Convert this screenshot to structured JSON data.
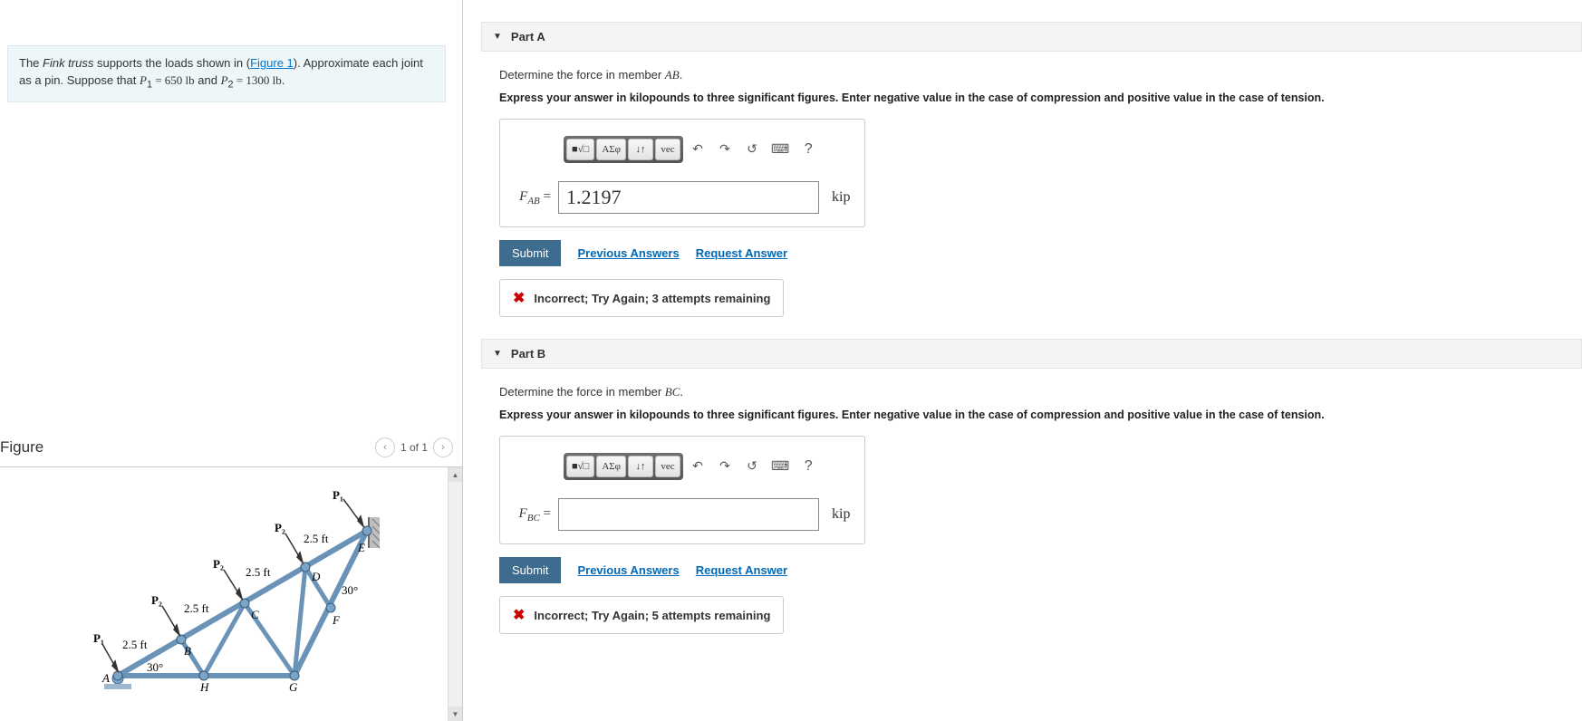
{
  "problem": {
    "html_segments": {
      "prefix": "The ",
      "italic": "Fink truss",
      "mid": " supports the loads shown in (",
      "link": "Figure 1",
      "suffix_before_vars": "). Approximate each joint as a pin. Suppose that ",
      "p1_var": "P",
      "p1_sub": "1",
      "p1_val": " = 650 lb",
      "and": " and ",
      "p2_var": "P",
      "p2_sub": "2",
      "p2_val": " = 1300 lb",
      "period": "."
    }
  },
  "figure": {
    "title": "Figure",
    "pager": "1 of 1",
    "labels": {
      "P1_left": "P₁",
      "P1_top": "P₁",
      "P2_a": "P₂",
      "P2_b": "P₂",
      "P2_c": "P₂",
      "d25_1": "2.5 ft",
      "d25_2": "2.5 ft",
      "d25_3": "2.5 ft",
      "d25_4": "2.5 ft",
      "ang30_l": "30°",
      "ang30_r": "30°",
      "A": "A",
      "B": "B",
      "C": "C",
      "D": "D",
      "E": "E",
      "F": "F",
      "G": "G",
      "H": "H"
    }
  },
  "parts": [
    {
      "id": "A",
      "title": "Part A",
      "prompt_prefix": "Determine the force in member ",
      "prompt_member": "AB",
      "prompt_suffix": ".",
      "instructions": "Express your answer in kilopounds to three significant figures. Enter negative value in the case of compression and positive value in the case of tension.",
      "var_label": "F",
      "var_sub": "AB",
      "equals": " = ",
      "input_value": "1.2197",
      "unit": "kip",
      "submit": "Submit",
      "prev_link": "Previous Answers",
      "request_link": "Request Answer",
      "feedback": "Incorrect; Try Again; 3 attempts remaining"
    },
    {
      "id": "B",
      "title": "Part B",
      "prompt_prefix": "Determine the force in member ",
      "prompt_member": "BC",
      "prompt_suffix": ".",
      "instructions": "Express your answer in kilopounds to three significant figures. Enter negative value in the case of compression and positive value in the case of tension.",
      "var_label": "F",
      "var_sub": "BC",
      "equals": " = ",
      "input_value": "",
      "unit": "kip",
      "submit": "Submit",
      "prev_link": "Previous Answers",
      "request_link": "Request Answer",
      "feedback": "Incorrect; Try Again; 5 attempts remaining"
    }
  ],
  "toolbar": {
    "templates": "■√□",
    "greek": "ΑΣφ",
    "arrows": "↓↑",
    "vec": "vec",
    "undo": "↶",
    "redo": "↷",
    "reset": "↺",
    "keyboard": "⌨",
    "help": "?"
  }
}
